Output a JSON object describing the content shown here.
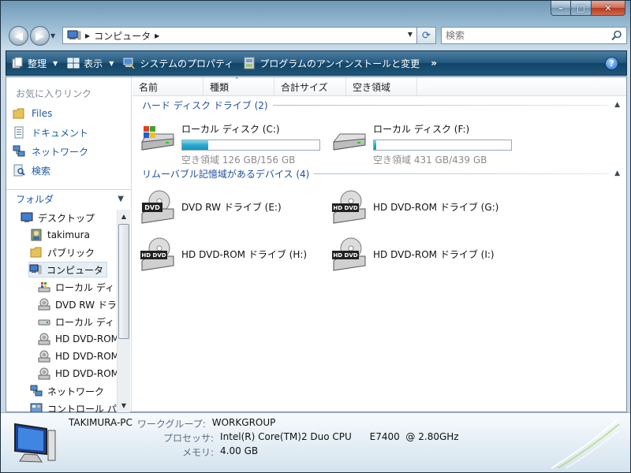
{
  "window": {
    "caption": {
      "minimize": "–",
      "maximize": "□",
      "close": "✕"
    }
  },
  "nav": {
    "breadcrumb": "コンピュータ",
    "search_placeholder": "検索"
  },
  "commands": {
    "organize": "整理",
    "views": "表示",
    "system_properties": "システムのプロパティ",
    "uninstall": "プログラムのアンインストールと変更",
    "more": "»",
    "help": "?"
  },
  "favorites": {
    "title": "お気に入りリンク",
    "items": [
      {
        "label": "Files",
        "icon": "folder-icon"
      },
      {
        "label": "ドキュメント",
        "icon": "documents-icon"
      },
      {
        "label": "ネットワーク",
        "icon": "network-icon"
      },
      {
        "label": "検索",
        "icon": "search-folder-icon"
      }
    ]
  },
  "folders": {
    "title": "フォルダ",
    "tree": [
      {
        "label": "デスクトップ",
        "icon": "desktop-icon",
        "level": 1
      },
      {
        "label": "takimura",
        "icon": "user-icon",
        "level": 2
      },
      {
        "label": "パブリック",
        "icon": "folder-icon",
        "level": 2
      },
      {
        "label": "コンピュータ",
        "icon": "computer-icon",
        "level": 2,
        "selected": true
      },
      {
        "label": "ローカル ディ",
        "icon": "windows-drive-icon",
        "level": 3
      },
      {
        "label": "DVD RW ドラ",
        "icon": "dvd-drive-icon",
        "level": 3
      },
      {
        "label": "ローカル ディ",
        "icon": "hard-drive-icon",
        "level": 3
      },
      {
        "label": "HD DVD-ROM",
        "icon": "dvd-drive-icon",
        "level": 3
      },
      {
        "label": "HD DVD-ROM",
        "icon": "dvd-drive-icon",
        "level": 3
      },
      {
        "label": "HD DVD-ROM",
        "icon": "dvd-drive-icon",
        "level": 3
      },
      {
        "label": "ネットワーク",
        "icon": "network-icon",
        "level": 2
      },
      {
        "label": "コントロール パ",
        "icon": "control-panel-icon",
        "level": 2
      }
    ]
  },
  "columns": [
    "名前",
    "種類",
    "合計サイズ",
    "空き領域"
  ],
  "groups": {
    "hard_disks": "ハード ディスク ドライブ (2)",
    "removable": "リムーバブル記憶域があるデバイス (4)"
  },
  "disks": [
    {
      "name": "ローカル ディスク (C:)",
      "free_text": "空き領域 126 GB/156 GB",
      "used_fraction": 0.19
    },
    {
      "name": "ローカル ディスク (F:)",
      "free_text": "空き領域 431 GB/439 GB",
      "used_fraction": 0.02
    }
  ],
  "removable_devices": [
    {
      "name": "DVD RW ドライブ (E:)",
      "badge": "DVD"
    },
    {
      "name": "HD DVD-ROM ドライブ (G:)",
      "badge": "HD DVD"
    },
    {
      "name": "HD DVD-ROM ドライブ (H:)",
      "badge": "HD DVD"
    },
    {
      "name": "HD DVD-ROM ドライブ (I:)",
      "badge": "HD DVD"
    }
  ],
  "details": {
    "pc_name": "TAKIMURA-PC",
    "workgroup_label": "ワークグループ:",
    "workgroup": "WORKGROUP",
    "processor_label": "プロセッサ:",
    "processor": "Intel(R) Core(TM)2 Duo CPU      E7400  @ 2.80GHz",
    "memory_label": "メモリ:",
    "memory": "4.00 GB"
  }
}
